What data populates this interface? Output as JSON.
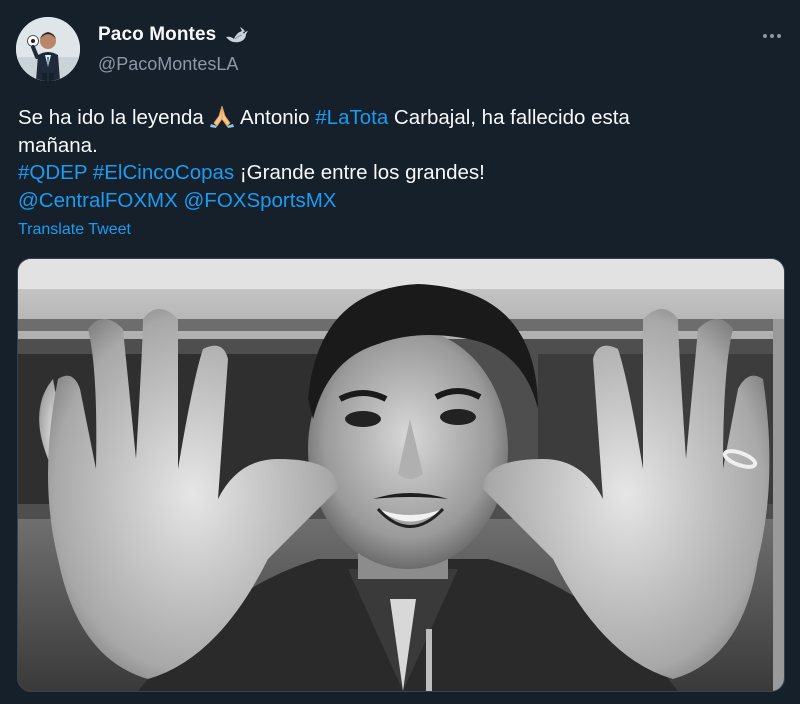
{
  "author": {
    "display_name": "Paco Montes",
    "handle": "@PacoMontesLA",
    "avatar_icon": "profile-avatar",
    "badge_icon": "dove-icon"
  },
  "menu": {
    "more_icon": "more-options-icon"
  },
  "tweet": {
    "line1_a": "Se ha ido la leyenda ",
    "line1_emoji": "pray-emoji",
    "line1_b": " Antonio ",
    "line1_hashtag": "#LaTota",
    "line1_c": " Carbajal, ha fallecido esta",
    "line2": "mañana.",
    "line3_hashtag1": "#QDEP",
    "line3_hashtag2": "#ElCincoCopas",
    "line3_text": " ¡Grande entre los grandes!",
    "line4_mention1": "@CentralFOXMX",
    "line4_mention2": "@FOXSportsMX"
  },
  "translate_label": "Translate Tweet",
  "colors": {
    "background": "#15202b",
    "text": "#f7f9f9",
    "secondary": "#8b98a5",
    "link": "#1d9bf0"
  }
}
